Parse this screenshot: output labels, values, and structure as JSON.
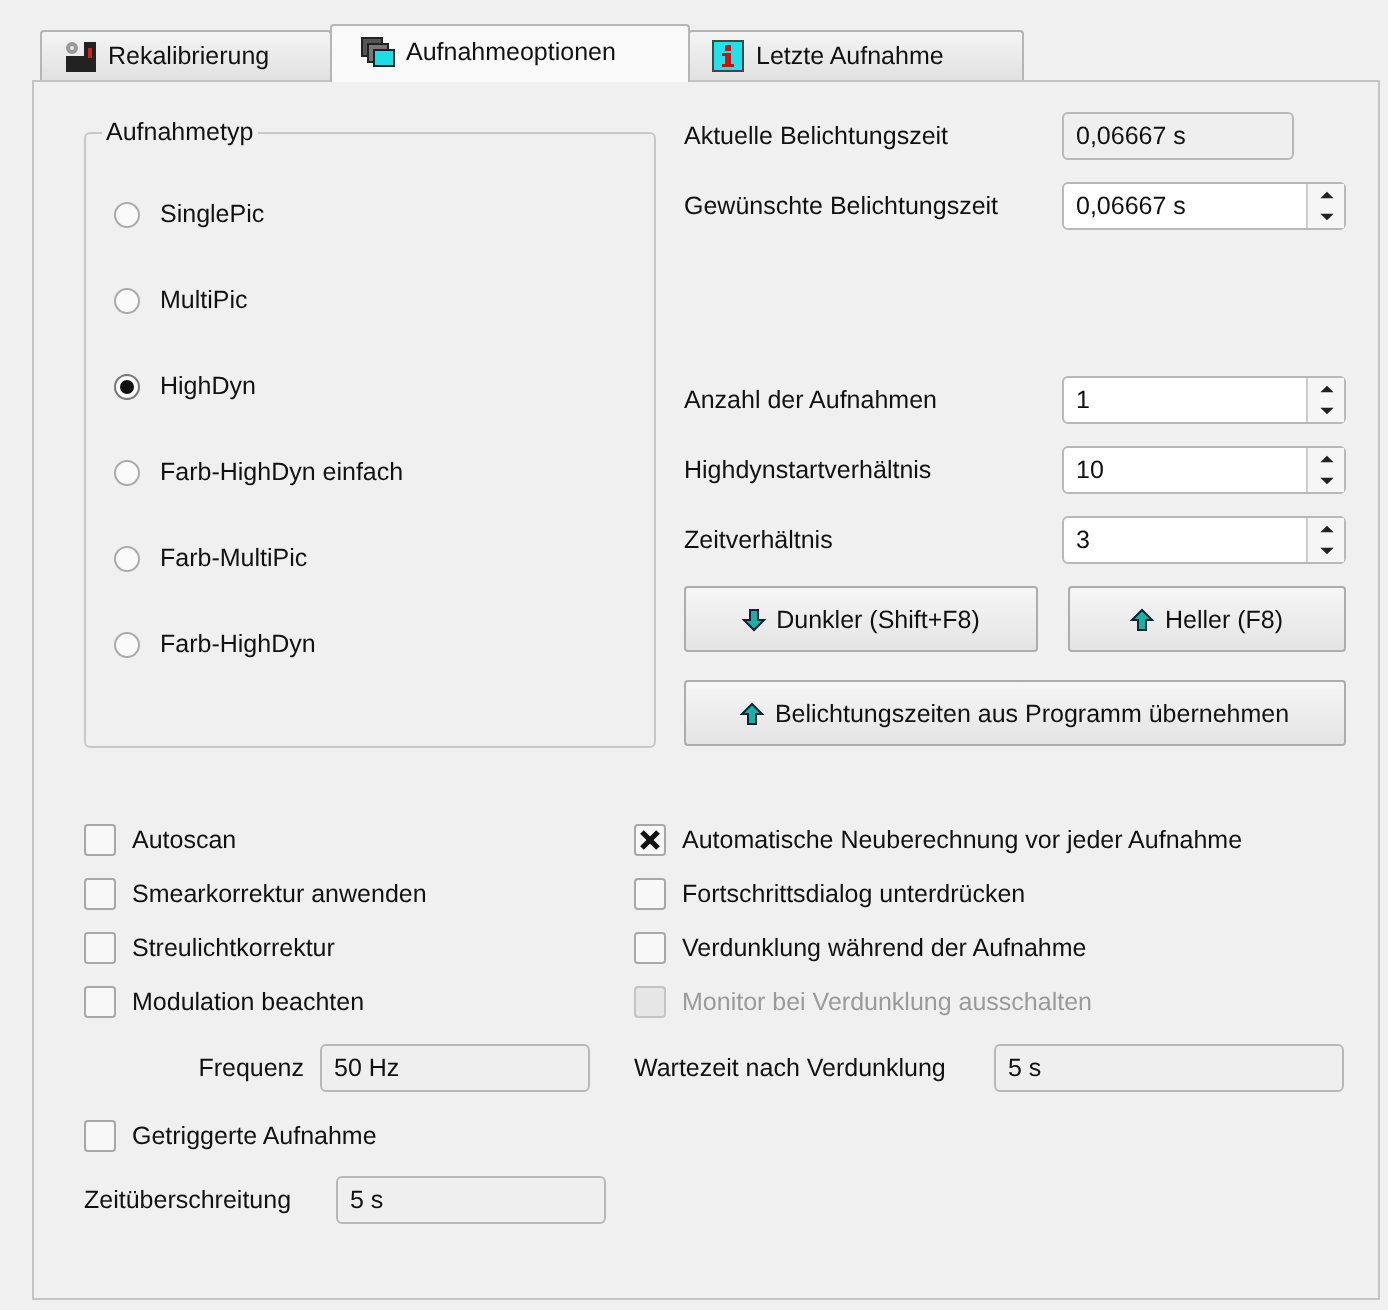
{
  "tabs": [
    {
      "label": "Rekalibrierung",
      "kind": "calibration",
      "selected": false
    },
    {
      "label": "Aufnahmeoptionen",
      "kind": "options",
      "selected": true
    },
    {
      "label": "Letzte Aufnahme",
      "kind": "info",
      "selected": false
    }
  ],
  "capture_type": {
    "title": "Aufnahmetyp",
    "options": [
      {
        "label": "SinglePic",
        "selected": false
      },
      {
        "label": "MultiPic",
        "selected": false
      },
      {
        "label": "HighDyn",
        "selected": true
      },
      {
        "label": "Farb-HighDyn einfach",
        "selected": false
      },
      {
        "label": "Farb-MultiPic",
        "selected": false
      },
      {
        "label": "Farb-HighDyn",
        "selected": false
      }
    ]
  },
  "exposure": [
    {
      "label": "Aktuelle Belichtungszeit",
      "value": "0,06667 s",
      "kind": "readonly"
    },
    {
      "label": "Gewünschte Belichtungszeit",
      "value": "0,06667 s",
      "kind": "spin"
    }
  ],
  "series": [
    {
      "label": "Anzahl der Aufnahmen",
      "value": "1",
      "kind": "spin"
    },
    {
      "label": "Highdynstartverhältnis",
      "value": "10",
      "kind": "spin"
    },
    {
      "label": "Zeitverhältnis",
      "value": "3",
      "kind": "spin"
    }
  ],
  "step_buttons": [
    {
      "label": "Dunkler (Shift+F8)",
      "kind": "down"
    },
    {
      "label": "Heller (F8)",
      "kind": "up"
    }
  ],
  "apply_button": {
    "label": "Belichtungszeiten aus Programm übernehmen",
    "kind": "up"
  },
  "left_options": [
    {
      "label": "Autoscan",
      "checked": false,
      "disabled": false
    },
    {
      "label": "Smearkorrektur anwenden",
      "checked": false,
      "disabled": false
    },
    {
      "label": "Streulichtkorrektur",
      "checked": false,
      "disabled": false
    },
    {
      "label": "Modulation beachten",
      "checked": false,
      "disabled": false
    }
  ],
  "frequency": {
    "label": "Frequenz",
    "value": "50 Hz"
  },
  "triggered": {
    "label": "Getriggerte Aufnahme",
    "checked": false,
    "disabled": false
  },
  "timeout": {
    "label": "Zeitüberschreitung",
    "value": "5 s"
  },
  "right_options": [
    {
      "label": "Automatische Neuberechnung vor jeder Aufnahme",
      "checked": true,
      "disabled": false
    },
    {
      "label": "Fortschrittsdialog unterdrücken",
      "checked": false,
      "disabled": false
    },
    {
      "label": "Verdunklung während der Aufnahme",
      "checked": false,
      "disabled": false
    },
    {
      "label": "Monitor bei Verdunklung ausschalten",
      "checked": false,
      "disabled": true
    }
  ],
  "wait_after_darkening": {
    "label": "Wartezeit nach Verdunklung",
    "value": "5 s"
  }
}
